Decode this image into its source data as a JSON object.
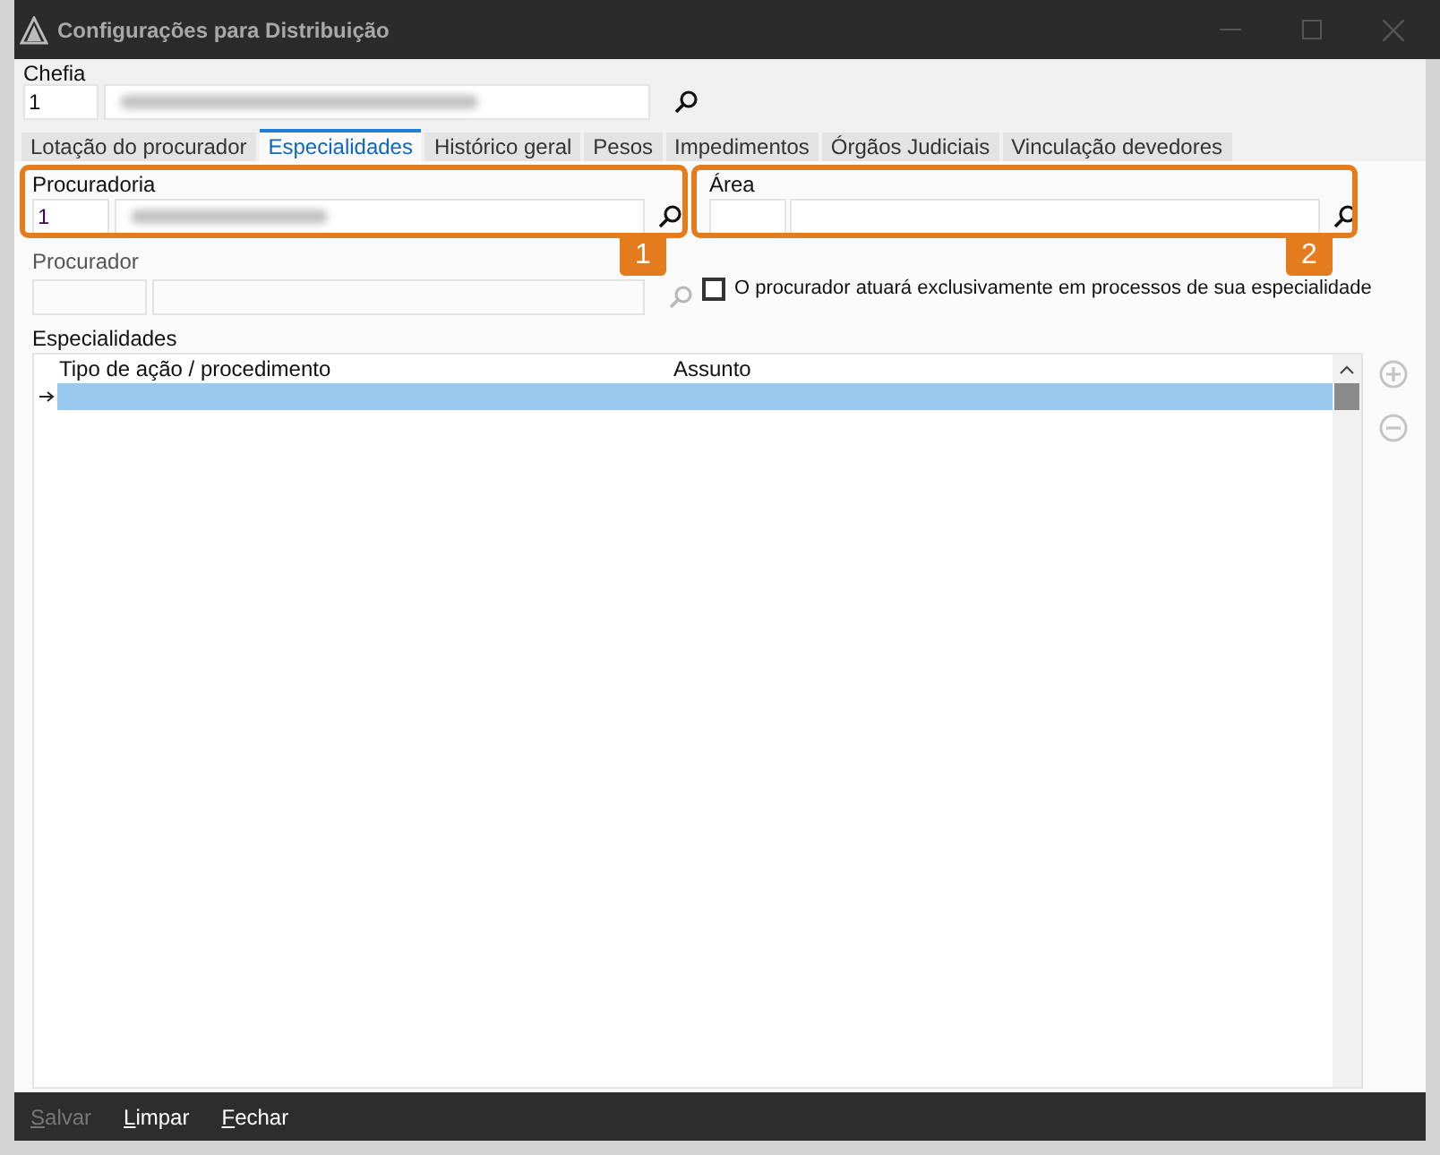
{
  "window": {
    "title": "Configurações para Distribuição"
  },
  "chefia": {
    "label": "Chefia",
    "code": "1"
  },
  "tabs": [
    {
      "label": "Lotação do procurador",
      "selected": false
    },
    {
      "label": "Especialidades",
      "selected": true
    },
    {
      "label": "Histórico geral",
      "selected": false
    },
    {
      "label": "Pesos",
      "selected": false
    },
    {
      "label": "Impedimentos",
      "selected": false
    },
    {
      "label": "Órgãos Judiciais",
      "selected": false
    },
    {
      "label": "Vinculação devedores",
      "selected": false
    }
  ],
  "procuradoria": {
    "label": "Procuradoria",
    "code": "1",
    "callout": "1"
  },
  "area": {
    "label": "Área",
    "callout": "2"
  },
  "procurador": {
    "label": "Procurador",
    "disabled": true
  },
  "exclusive": {
    "label": "O procurador atuará exclusivamente em processos de sua especialidade",
    "checked": false
  },
  "especialidades": {
    "label": "Especialidades",
    "columns": [
      "Tipo de ação / procedimento",
      "Assunto"
    ],
    "rows": [
      {
        "selected": true
      }
    ]
  },
  "buttons": [
    {
      "label": "Salvar",
      "disabled": true
    },
    {
      "label": "Limpar",
      "disabled": false
    },
    {
      "label": "Fechar",
      "disabled": false
    }
  ]
}
